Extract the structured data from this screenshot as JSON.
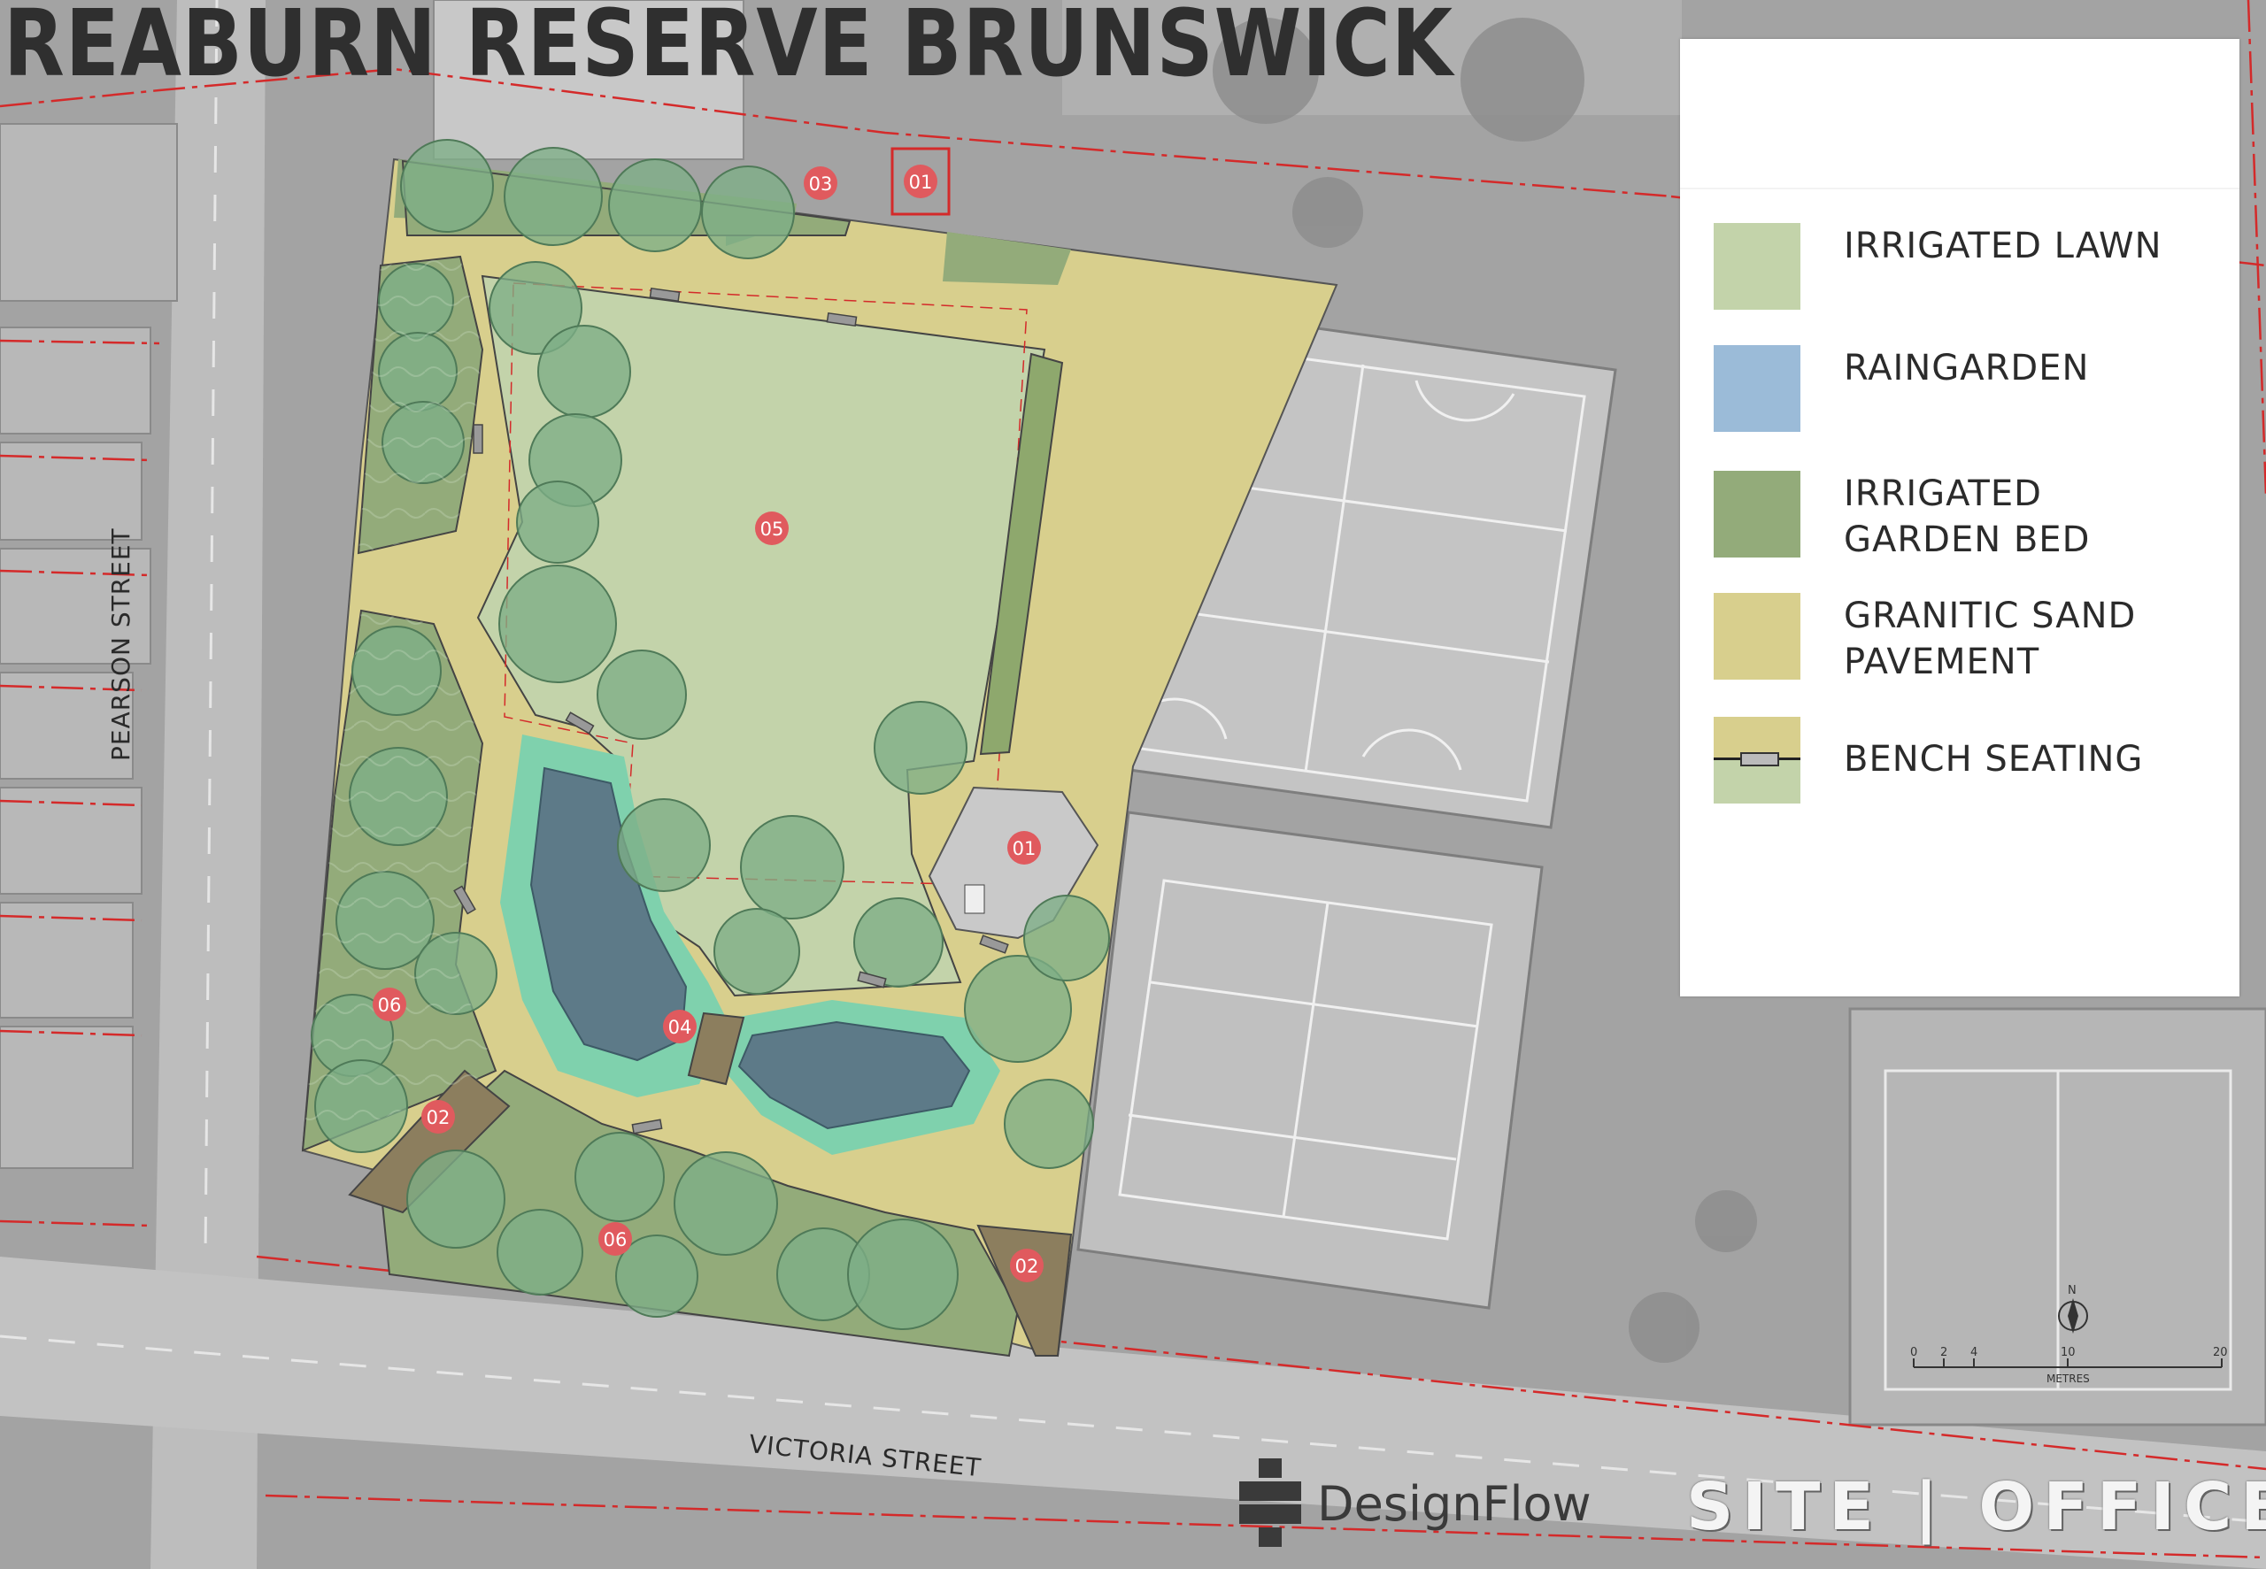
{
  "title": "REABURN RESERVE BRUNSWICK",
  "legend": [
    {
      "label": "IRRIGATED LAWN",
      "color": "#c3d3aa"
    },
    {
      "label": "RAINGARDEN",
      "color": "#9bbbd8"
    },
    {
      "label": "IRRIGATED GARDEN BED",
      "color": "#93ab7a"
    },
    {
      "label": "GRANITIC SAND PAVEMENT",
      "color": "#d8cf8d"
    },
    {
      "label": "BENCH SEATING",
      "color": "#d8cf8d"
    }
  ],
  "streets": {
    "pearson": "PEARSON STREET",
    "victoria": "VICTORIA STREET"
  },
  "markers": [
    "01",
    "01",
    "02",
    "02",
    "03",
    "04",
    "05",
    "06",
    "06"
  ],
  "scale": {
    "ticks": [
      "0",
      "2",
      "4",
      "10",
      "20"
    ],
    "unit": "METRES",
    "north": "N"
  },
  "logos": {
    "designflow": "DesignFlow",
    "site_office": "SITE | OFFICE"
  },
  "colors": {
    "lawn": "#c3d3aa",
    "raingarden": "#9bbbd8",
    "garden_bed": "#93ab7a",
    "sand": "#d8cf8d",
    "marker": "#e05a5e",
    "boundary": "#d42a2a"
  }
}
